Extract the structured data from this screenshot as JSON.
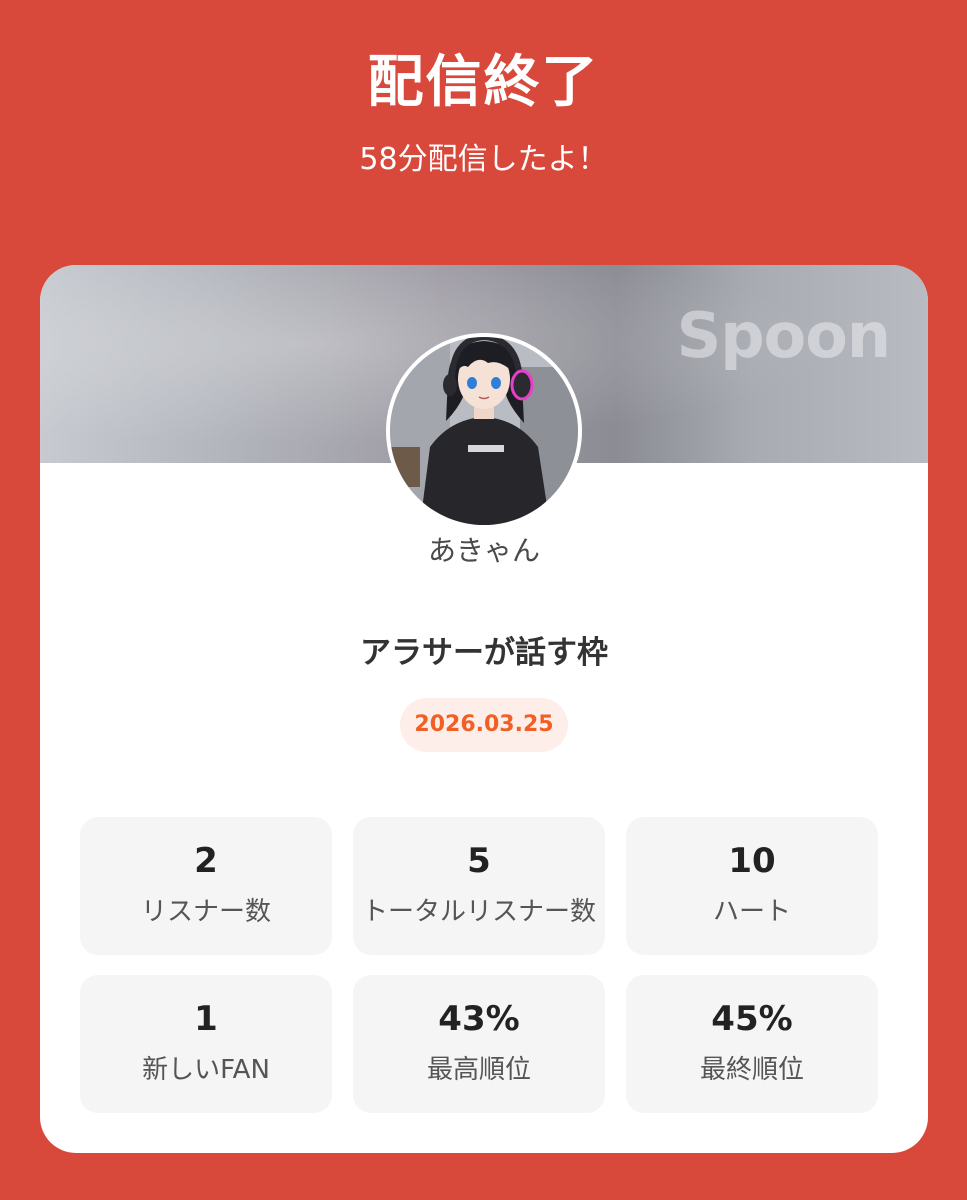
{
  "header": {
    "title": "配信終了",
    "subtitle": "58分配信したよ！"
  },
  "card": {
    "brand": "Spoon",
    "user_name": "あきゃん",
    "stream_title": "アラサーが話す枠",
    "date": "2026.03.25",
    "avatar_icon": "user-avatar-icon",
    "stats": [
      {
        "value": "2",
        "label": "リスナー数"
      },
      {
        "value": "5",
        "label": "トータルリスナー数"
      },
      {
        "value": "10",
        "label": "ハート"
      },
      {
        "value": "1",
        "label": "新しいFAN"
      },
      {
        "value": "43%",
        "label": "最高順位"
      },
      {
        "value": "45%",
        "label": "最終順位"
      }
    ]
  },
  "colors": {
    "background": "#d9493b",
    "date_text": "#f15f24",
    "date_badge_bg": "#fdeee9",
    "tile_bg": "#f5f5f5"
  }
}
